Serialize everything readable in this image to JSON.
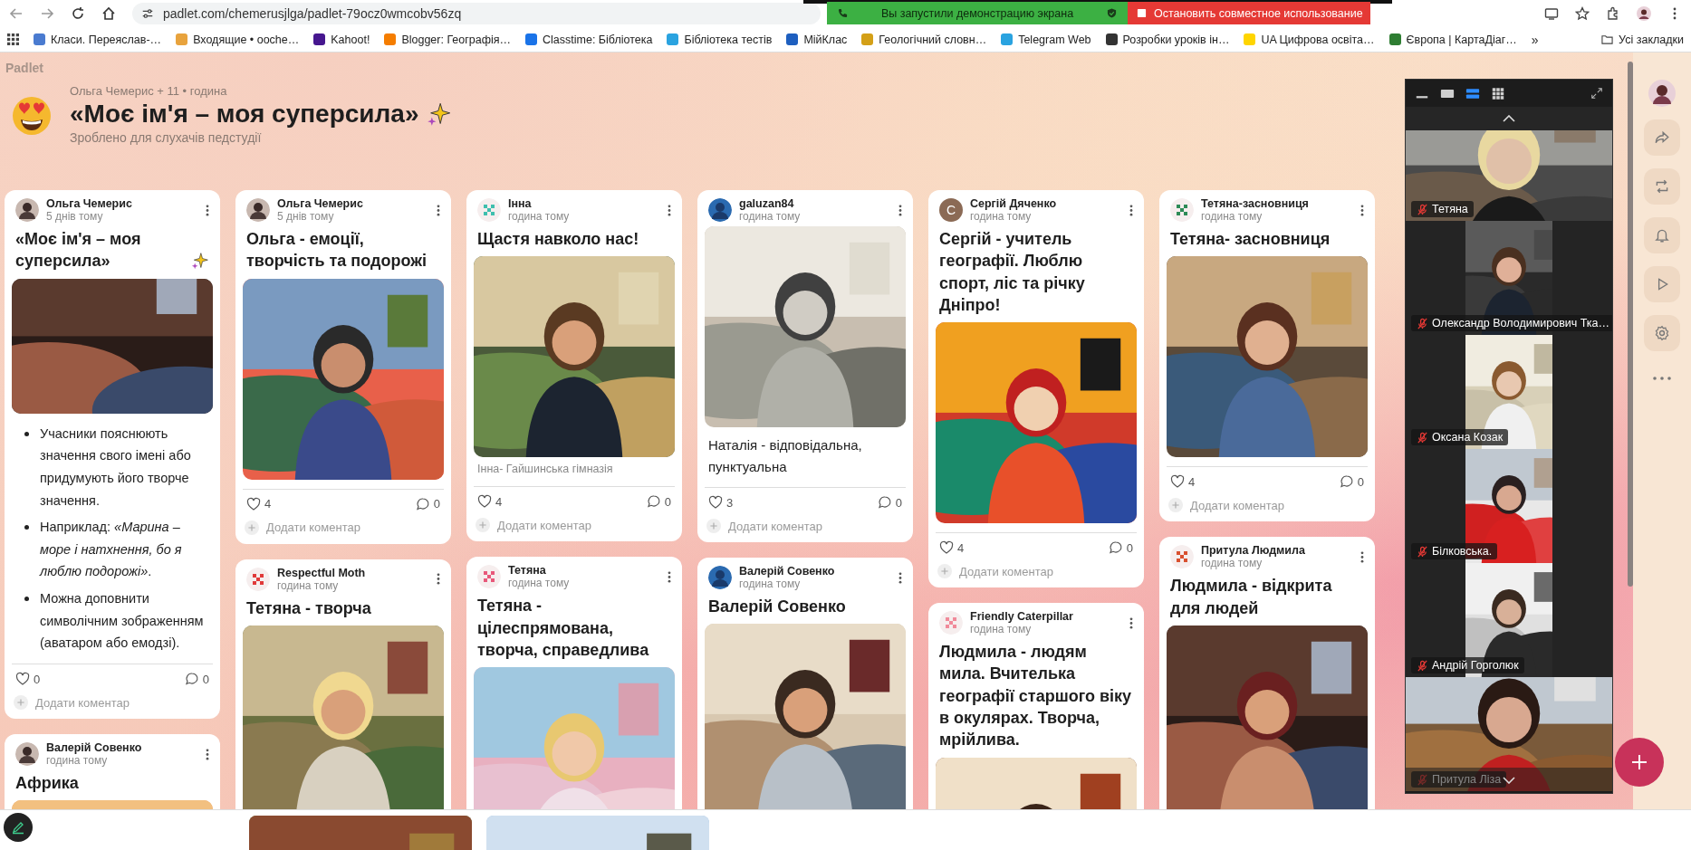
{
  "browser": {
    "url": "padlet.com/chemerusjlga/padlet-79ocz0wmcobv56zq",
    "bookmarks": [
      {
        "label": "Класи. Переяслав-…",
        "color": "#4a7bd0"
      },
      {
        "label": "Входящие • ooche…",
        "color": "#e8a33d"
      },
      {
        "label": "Kahoot!",
        "color": "#46178f"
      },
      {
        "label": "Blogger: Географія…",
        "color": "#f57d00"
      },
      {
        "label": "Classtime: Бібліотека",
        "color": "#1a73e8"
      },
      {
        "label": "Бібліотека тестів",
        "color": "#2aa3e0"
      },
      {
        "label": "МійКлас",
        "color": "#1e5fbf"
      },
      {
        "label": "Геологічний словн…",
        "color": "#d4a017"
      },
      {
        "label": "Telegram Web",
        "color": "#2aa3e0"
      },
      {
        "label": "Розробки уроків ін…",
        "color": "#333333"
      },
      {
        "label": "UA Цифрова освіта…",
        "color": "#ffd500"
      },
      {
        "label": "Європа | КартаДіаг…",
        "color": "#2e7d32"
      }
    ],
    "more": "»",
    "all_bookmarks": "Усі закладки"
  },
  "share_banner": {
    "message": "Вы запустили демонстрацию экрана",
    "stop": "Остановить совместное использование"
  },
  "board": {
    "brand": "Padlet",
    "byline": "Ольга Чемерис + 11 • година",
    "title": "«Моє ім'я – моя суперсила»",
    "title_sparkle": true,
    "subtitle": "Зроблено для слухачів педстудії"
  },
  "columns": [
    {
      "posts": [
        {
          "author": "Ольга Чемерис",
          "time": "5 днів тому",
          "title": "«Моє ім'я – моя суперсила»",
          "title_sparkle": true,
          "body": {
            "kind": "bullets",
            "items": [
              "Учасники пояснюють значення свого імені або придумують його творче значення.",
              "Наприклад: *«Марина – море і натхнення, бо я люблю подорожі»*.",
              "Можна доповнити символічним зображенням (аватаром або емодзі)."
            ]
          },
          "likes": "0",
          "comments": "0",
          "add_comment": "Додати коментар"
        },
        {
          "author": "Валерій Совенко",
          "time": "година тому",
          "title": "Африка"
        }
      ]
    },
    {
      "posts": [
        {
          "author": "Ольга Чемерис",
          "time": "5 днів тому",
          "title": "Ольга - емоції, творчість та подорожі",
          "likes": "4",
          "comments": "0",
          "add_comment": "Додати коментар"
        },
        {
          "author": "Respectful Moth",
          "time": "година тому",
          "avatar": {
            "kind": "pixel",
            "color": "#e03a3a"
          },
          "title": "Тетяна - творча"
        }
      ]
    },
    {
      "posts": [
        {
          "author": "Інна",
          "time": "година тому",
          "avatar": {
            "kind": "pixel",
            "color": "#3fbfae"
          },
          "title": "Щастя навколо нас!",
          "body": {
            "kind": "caption",
            "text": "Інна- Гайшинська гімназія"
          },
          "likes": "4",
          "comments": "0",
          "add_comment": "Додати коментар"
        },
        {
          "author": "Тетяна",
          "time": "година тому",
          "avatar": {
            "kind": "pixel",
            "color": "#e8587a"
          },
          "title": "Тетяна - цілеспрямована, творча, справедлива"
        }
      ]
    },
    {
      "posts": [
        {
          "author": "galuzan84",
          "time": "година тому",
          "body": {
            "kind": "text",
            "text": "Наталія - відповідальна, пунктуальна"
          },
          "likes": "3",
          "comments": "0",
          "add_comment": "Додати коментар"
        },
        {
          "author": "Валерій Совенко",
          "time": "година тому",
          "title": "Валерій Совенко"
        }
      ]
    },
    {
      "posts": [
        {
          "author": "Сергій Дяченко",
          "time": "година тому",
          "avatar": {
            "kind": "letter",
            "letter": "С",
            "color": "#8b6a55"
          },
          "title": "Сергій - учитель географії. Люблю спорт, ліс та річку Дніпро!",
          "likes": "4",
          "comments": "0",
          "add_comment": "Додати коментар"
        },
        {
          "author": "Friendly Caterpillar",
          "time": "година тому",
          "avatar": {
            "kind": "pixel",
            "color": "#f08a9a"
          },
          "title": "Людмила - людям мила. Вчителька географії старшого віку в окулярах. Творча, мрійлива."
        }
      ]
    },
    {
      "posts": [
        {
          "author": "Тетяна-засновниця",
          "time": "година тому",
          "avatar": {
            "kind": "pixel",
            "color": "#2e8b57"
          },
          "title": "Тетяна- засновниця",
          "likes": "4",
          "comments": "0",
          "add_comment": "Додати коментар"
        },
        {
          "author": "Притула Людмила",
          "time": "година тому",
          "avatar": {
            "kind": "pixel",
            "color": "#d9502f"
          },
          "title": "Людмила - відкрита для людей"
        }
      ]
    }
  ],
  "meeting": {
    "view_modes": [
      {
        "kind": "minimized",
        "selected": false
      },
      {
        "kind": "thumbnail",
        "selected": false
      },
      {
        "kind": "speaker",
        "selected": true
      },
      {
        "kind": "gallery",
        "selected": false
      }
    ],
    "participants": [
      {
        "name": "Тетяна",
        "muted": true,
        "kind": "wide"
      },
      {
        "name": "Олександр Володимирович Тка…",
        "muted": true,
        "kind": "portrait"
      },
      {
        "name": "Оксана Козак",
        "muted": true,
        "kind": "portrait"
      },
      {
        "name": "Білковська.",
        "muted": true,
        "kind": "portrait"
      },
      {
        "name": "Андрій Горголюк",
        "muted": true,
        "kind": "portrait"
      },
      {
        "name": "Притула Ліза",
        "muted": true,
        "kind": "wide"
      }
    ]
  }
}
